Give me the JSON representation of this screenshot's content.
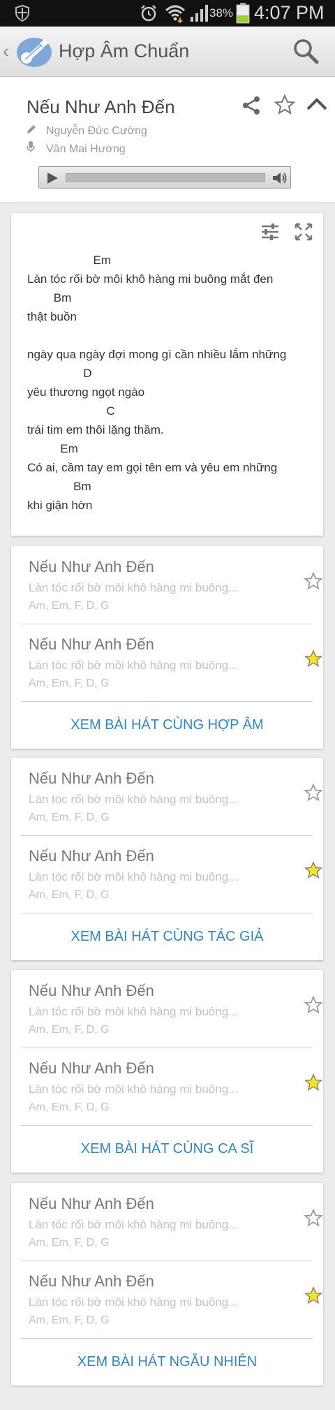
{
  "status_bar": {
    "battery_percent": "38%",
    "time": "4:07 PM",
    "icons": [
      "shield-icon",
      "alarm-icon",
      "wifi-icon",
      "signal-icon",
      "battery-icon"
    ]
  },
  "app_bar": {
    "title": "Hợp Âm Chuẩn",
    "icons": [
      "back-chevron-icon",
      "guitar-logo-icon",
      "search-icon"
    ]
  },
  "song": {
    "title": "Nếu Như Anh Đến",
    "author": "Nguyễn Đức Cường",
    "singer": "Văn Mai Hương",
    "icons": [
      "share-icon",
      "star-outline-icon",
      "chevron-up-icon",
      "pencil-icon",
      "microphone-icon"
    ],
    "player": {
      "icons": [
        "play-icon",
        "volume-icon"
      ]
    }
  },
  "lyrics": {
    "lines": [
      "                    Em",
      "Làn tóc rối bờ môi khô hàng mi buông mắt đen",
      "        Bm",
      "thật buồn",
      "",
      "ngày qua ngày đợi mong gì cần nhiều lắm những",
      "                 D",
      "yêu thương ngọt ngào",
      "                        C",
      "trái tim em thôi lặng thầm.",
      "          Em",
      "Có ai, cầm tay em gọi tên em và yêu em những",
      "              Bm",
      "khi giận hờn"
    ],
    "icons": [
      "tune-icon",
      "fullscreen-icon"
    ]
  },
  "sections": [
    {
      "items": [
        {
          "title": "Nếu Như Anh Đến",
          "lyric": "Làn tóc rối bờ môi khô hàng mi buông...",
          "chords": "Am, Em, F, D, G",
          "starred": false
        },
        {
          "title": "Nếu Như Anh Đến",
          "lyric": "Làn tóc rối bờ môi khô hàng mi buông...",
          "chords": "Am, Em, F, D, G",
          "starred": true
        }
      ],
      "more_label": "XEM BÀI HÁT CÙNG HỢP ÂM"
    },
    {
      "items": [
        {
          "title": "Nếu Như Anh Đến",
          "lyric": "Làn tóc rối bờ môi khô hàng mi buông...",
          "chords": "Am, Em, F, D, G",
          "starred": false
        },
        {
          "title": "Nếu Như Anh Đến",
          "lyric": "Làn tóc rối bờ môi khô hàng mi buông...",
          "chords": "Am, Em, F, D, G",
          "starred": true
        }
      ],
      "more_label": "XEM BÀI HÁT CÙNG TÁC GIẢ"
    },
    {
      "items": [
        {
          "title": "Nếu Như Anh Đến",
          "lyric": "Làn tóc rối bờ môi khô hàng mi buông...",
          "chords": "Am, Em, F, D, G",
          "starred": false
        },
        {
          "title": "Nếu Như Anh Đến",
          "lyric": "Làn tóc rối bờ môi khô hàng mi buông...",
          "chords": "Am, Em, F, D, G",
          "starred": true
        }
      ],
      "more_label": "XEM BÀI HÁT CÙNG CA SĨ"
    },
    {
      "items": [
        {
          "title": "Nếu Như Anh Đến",
          "lyric": "Làn tóc rối bờ môi khô hàng mi buông...",
          "chords": "Am, Em, F, D, G",
          "starred": false
        },
        {
          "title": "Nếu Như Anh Đến",
          "lyric": "Làn tóc rối bờ môi khô hàng mi buông...",
          "chords": "Am, Em, F, D, G",
          "starred": true
        }
      ],
      "more_label": "XEM BÀI HÁT NGẪU NHIÊN"
    }
  ],
  "colors": {
    "accent_link": "#2f86c6",
    "star_filled": "#f4e61e",
    "logo_blue": "#7fa7d8",
    "status_bar": "#111111"
  }
}
